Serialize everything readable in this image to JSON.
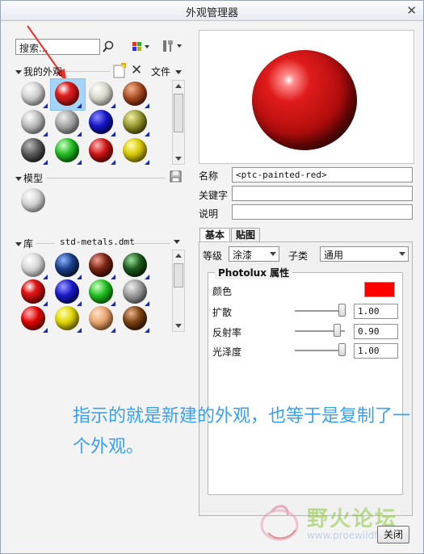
{
  "window": {
    "title": "外观管理器",
    "close_glyph": "✕"
  },
  "search": {
    "placeholder": "搜索...",
    "value": "搜索..."
  },
  "my_appearances": {
    "title": "我的外观",
    "file_menu": "文件"
  },
  "model": {
    "title": "模型"
  },
  "library": {
    "title": "库",
    "file": "std-metals.dmt"
  },
  "properties": {
    "name_label": "名称",
    "name_value": "<ptc-painted-red>",
    "keyword_label": "关键字",
    "keyword_value": "",
    "desc_label": "说明",
    "desc_value": ""
  },
  "tabs": [
    {
      "label": "基本",
      "active": true
    },
    {
      "label": "贴图",
      "active": false
    }
  ],
  "level": {
    "label": "等级",
    "value": "涂漆"
  },
  "subtype": {
    "label": "子类",
    "value": "通用"
  },
  "photolux": {
    "title": "Photolux 属性",
    "color_label": "颜色",
    "color": "#ff0000",
    "diffuse_label": "扩散",
    "diffuse_value": "1.00",
    "reflect_label": "反射率",
    "reflect_value": "0.90",
    "gloss_label": "光泽度",
    "gloss_value": "1.00"
  },
  "annotation": "指示的就是新建的外观，也等于是复制了一个外观。",
  "close_button": "关闭",
  "watermark": {
    "text": "野火论坛",
    "url": "www.proewildfire.cn"
  },
  "colors": {
    "accent": "#3aa0ea",
    "selection": "#a5d4f8",
    "arrow": "#e8312a"
  }
}
